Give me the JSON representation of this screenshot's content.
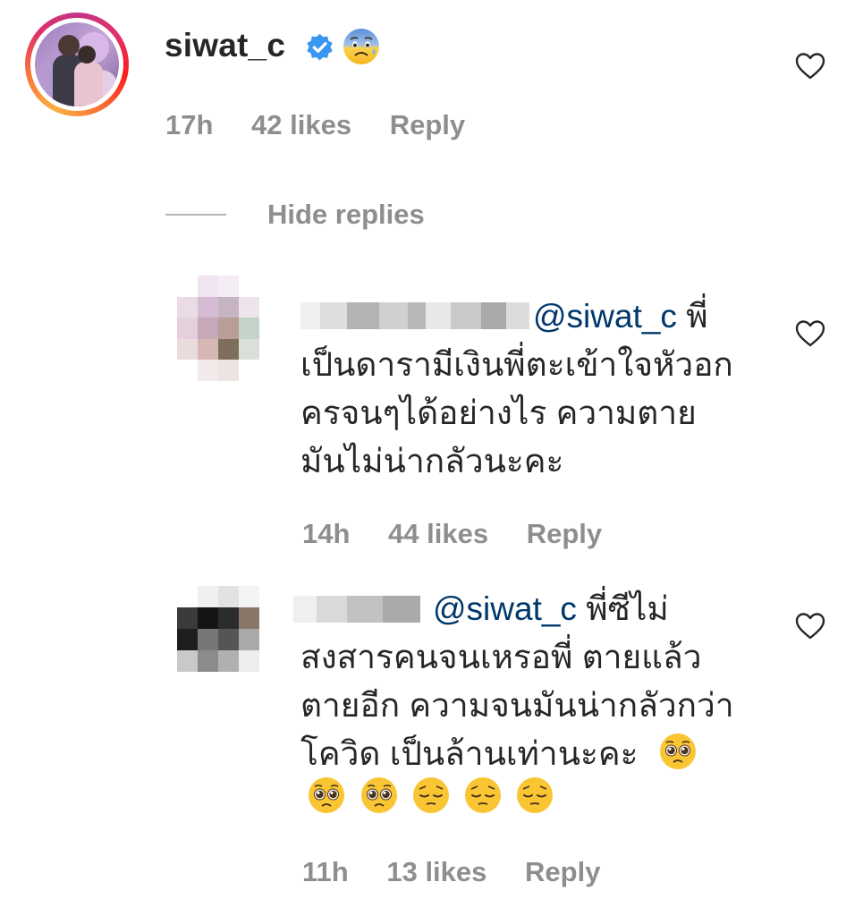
{
  "main_comment": {
    "username": "siwat_c",
    "time": "17h",
    "likes": "42 likes",
    "reply": "Reply",
    "emoji": "fearful-face-with-sweat"
  },
  "hide_replies": "Hide replies",
  "replies": [
    {
      "mention": "@siwat_c",
      "text_first": " พี่",
      "text_rest": "เป็นดารามีเงินพี่ตะเข้าใจหัวอก\nครจนๆได้อย่างไร ความตาย\nมันไม่น่ากลัวนะคะ",
      "time": "14h",
      "likes": "44 likes",
      "reply": "Reply"
    },
    {
      "mention": "@siwat_c",
      "text_first": " พี่ซีไม่",
      "text_rest": "สงสารคนจนเหรอพี่ ตายแล้ว\nตายอีก ความจนมันน่ากลัวกว่า\nโควิด เป็นล้านเท่านะคะ",
      "emojis": [
        "pleading-face",
        "pleading-face",
        "pleading-face",
        "pensive-face",
        "pensive-face",
        "pensive-face"
      ],
      "time": "11h",
      "likes": "13 likes",
      "reply": "Reply"
    }
  ],
  "icons": {
    "heart": "heart-outline-icon",
    "verified": "verified-badge-icon"
  },
  "colors": {
    "mention": "#00376b",
    "meta": "#8e8e8e",
    "verified": "#3897f0"
  }
}
